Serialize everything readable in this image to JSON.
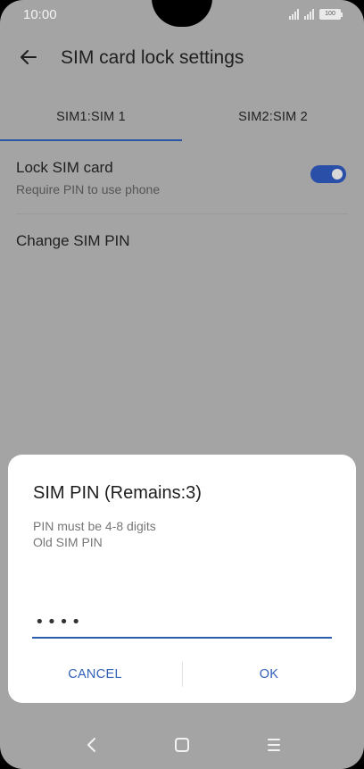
{
  "status_bar": {
    "time": "10:00",
    "battery": "100",
    "icons": [
      "signal-icon",
      "signal-icon",
      "battery-icon"
    ]
  },
  "app_bar": {
    "title": "SIM card lock settings",
    "back_icon": "arrow-left-icon"
  },
  "tabs": [
    {
      "label": "SIM1:SIM 1",
      "selected": true
    },
    {
      "label": "SIM2:SIM 2",
      "selected": false
    }
  ],
  "settings": {
    "lock_sim": {
      "title": "Lock SIM card",
      "subtitle": "Require PIN to use phone",
      "enabled": true
    },
    "change_pin": {
      "title": "Change SIM PIN"
    }
  },
  "dialog": {
    "title": "SIM PIN (Remains:3)",
    "message_1": "PIN must be 4-8 digits",
    "message_2": "Old SIM PIN",
    "pin_value": "••••",
    "cancel_label": "CANCEL",
    "ok_label": "OK"
  },
  "nav_bar": {
    "icons": [
      "nav-back-icon",
      "nav-home-icon",
      "nav-menu-icon"
    ]
  },
  "colors": {
    "accent": "#2a56a4",
    "scrim_background": "#a4a4a4",
    "dialog_background": "#ffffff",
    "button_text": "#3060b8"
  }
}
